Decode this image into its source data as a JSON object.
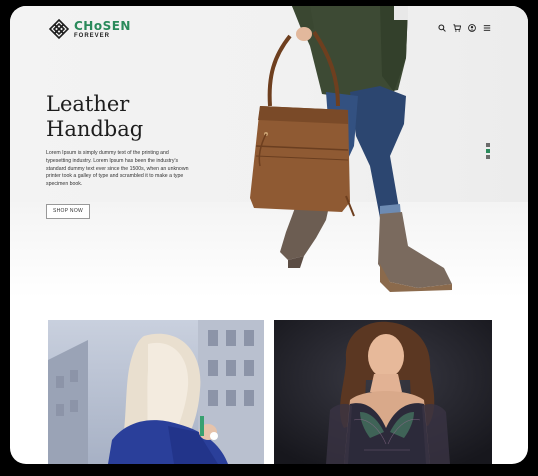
{
  "brand": {
    "name": "CHoSEN",
    "tagline": "FOREVER",
    "accent_color": "#2a8a5b"
  },
  "nav": {
    "icons": [
      "search-icon",
      "cart-icon",
      "user-icon",
      "menu-icon"
    ]
  },
  "hero": {
    "title_line1": "Leather",
    "title_line2": "Handbag",
    "description": "Lorem Ipsum is simply dummy text of the printing and typesetting industry. Lorem Ipsum has been the industry's standard dummy text ever since the 1500s, when an unknown printer took a galley of type and scrambled it to make a type specimen book.",
    "cta_label": "SHOP NOW",
    "slides_total": 3,
    "active_slide": 2
  },
  "products": [
    {
      "name": "woman-blonde-blue-jacket"
    },
    {
      "name": "woman-lace-lingerie"
    }
  ]
}
